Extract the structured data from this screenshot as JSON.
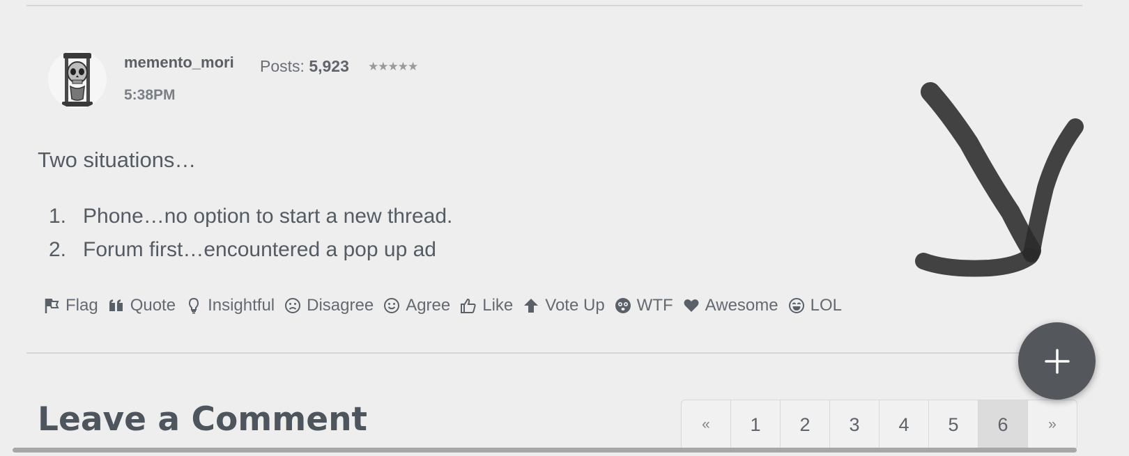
{
  "post": {
    "author": "memento_mori",
    "posts_label": "Posts:",
    "posts_count": "5,923",
    "stars": "★★★★★",
    "time": "5:38PM",
    "intro": "Two situations…",
    "list": [
      {
        "num": "1.",
        "text": "Phone…no option to start a new thread."
      },
      {
        "num": "2.",
        "text": "Forum first…encountered a pop up ad"
      }
    ]
  },
  "reactions": [
    {
      "label": "Flag",
      "icon": "flag-icon"
    },
    {
      "label": "Quote",
      "icon": "quote-icon"
    },
    {
      "label": "Insightful",
      "icon": "lightbulb-icon"
    },
    {
      "label": "Disagree",
      "icon": "frown-icon"
    },
    {
      "label": "Agree",
      "icon": "smile-icon"
    },
    {
      "label": "Like",
      "icon": "thumbs-up-icon"
    },
    {
      "label": "Vote Up",
      "icon": "arrow-up-icon"
    },
    {
      "label": "WTF",
      "icon": "dizzy-face-icon"
    },
    {
      "label": "Awesome",
      "icon": "heart-icon"
    },
    {
      "label": "LOL",
      "icon": "laugh-icon"
    }
  ],
  "comment": {
    "heading": "Leave a Comment"
  },
  "pagination": {
    "prev": "«",
    "pages": [
      "1",
      "2",
      "3",
      "4",
      "5",
      "6"
    ],
    "next": "»",
    "current": "6"
  },
  "fab": {
    "icon": "plus-icon"
  },
  "annotation": {
    "icon": "hand-drawn-arrow-icon"
  },
  "colors": {
    "background": "#eeeeee",
    "text": "#555b63",
    "fab": "#54585d",
    "active_page": "#dcdcdc"
  }
}
